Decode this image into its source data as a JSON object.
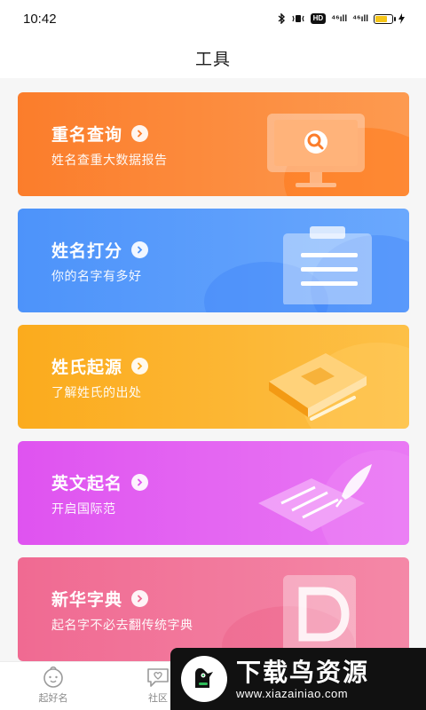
{
  "status_bar": {
    "time": "10:42",
    "bluetooth_icon": "bluetooth-icon",
    "hd_badge": "HD",
    "signal1": "⁴⁶ıll",
    "signal2": "⁴⁶ıll",
    "battery_level": 0.7
  },
  "header": {
    "title": "工具"
  },
  "cards": [
    {
      "title": "重名查询",
      "subtitle": "姓名查重大数据报告",
      "icon": "monitor-search-icon",
      "accent": "#fb7d2b"
    },
    {
      "title": "姓名打分",
      "subtitle": "你的名字有多好",
      "icon": "clipboard-icon",
      "accent": "#4d93fa"
    },
    {
      "title": "姓氏起源",
      "subtitle": "了解姓氏的出处",
      "icon": "book-icon",
      "accent": "#fbab1d"
    },
    {
      "title": "英文起名",
      "subtitle": "开启国际范",
      "icon": "quill-paper-icon",
      "accent": "#df53f0"
    },
    {
      "title": "新华字典",
      "subtitle": "起名字不必去翻传统字典",
      "icon": "dictionary-icon",
      "accent": "#f06a92"
    }
  ],
  "bottom_nav": [
    {
      "label": "起好名",
      "icon": "baby-face-icon"
    },
    {
      "label": "社区",
      "icon": "heart-chat-icon"
    }
  ],
  "watermark": {
    "title": "下载鸟资源",
    "url": "www.xiazainiao.com"
  }
}
